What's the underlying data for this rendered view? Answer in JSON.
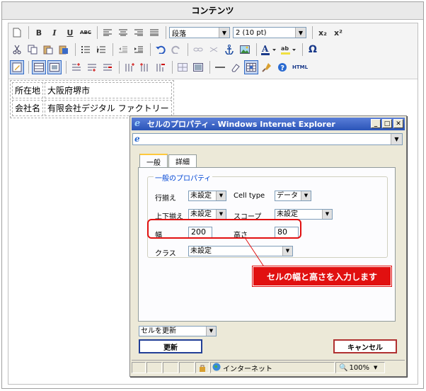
{
  "panel_title": "コンテンツ",
  "toolbar": {
    "row1": [
      "new-doc-icon",
      "bold-icon",
      "italic-icon",
      "underline-icon",
      "strikethrough-icon",
      "align-left-icon",
      "align-center-icon",
      "align-right-icon",
      "align-justify-icon"
    ],
    "bold_label": "B",
    "italic_label": "I",
    "underline_label": "U",
    "strike_label": "ABC",
    "format_select": "段落",
    "size_select": "2 (10 pt)",
    "subscript_label": "x₂",
    "superscript_label": "x²",
    "omega_label": "Ω",
    "html_label": "HTML"
  },
  "content_table": [
    [
      "所在地",
      "大阪府堺市"
    ],
    [
      "会社名",
      "有限会社デジタル ファクトリー"
    ]
  ],
  "dialog": {
    "title": "セルのプロパティ - Windows Internet Explorer",
    "tabs": [
      {
        "label": "一般",
        "active": true
      },
      {
        "label": "詳細",
        "active": false
      }
    ],
    "legend": "一般のプロパティ",
    "fields": {
      "row_align_label": "行揃え",
      "row_align_value": "未設定",
      "cell_type_label": "Cell type",
      "cell_type_value": "データ",
      "valign_label": "上下揃え",
      "valign_value": "未設定",
      "scope_label": "スコープ",
      "scope_value": "未設定",
      "width_label": "幅",
      "width_value": "200",
      "height_label": "高さ",
      "height_value": "80",
      "class_label": "クラス",
      "class_value": "未設定"
    },
    "callout": "セルの幅と高さを入力します",
    "action_select": "セルを更新",
    "update_button": "更新",
    "cancel_button": "キャンセル",
    "status": {
      "zone": "インターネット",
      "zoom": "100%"
    }
  }
}
